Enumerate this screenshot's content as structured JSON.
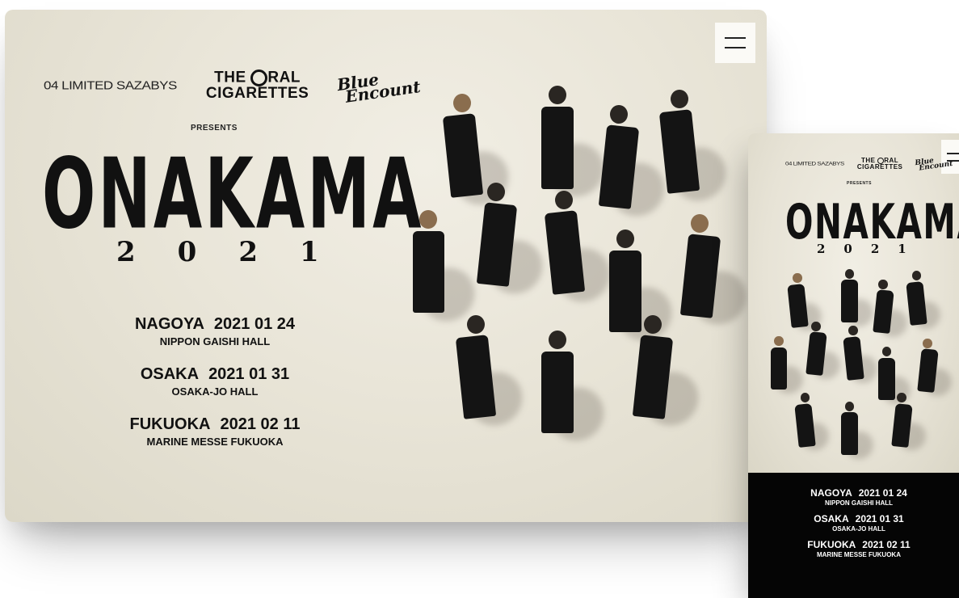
{
  "sponsors": {
    "ufs": "04 LIMITED SAZABYS",
    "toc_line1_a": "THE",
    "toc_line1_b": "RAL",
    "toc_line2": "CIGARETTES",
    "blue_line1": "Blue",
    "blue_line2": "Encount"
  },
  "presents": "PRESENTS",
  "title": "ONAKAMA",
  "year": "2021",
  "dates": [
    {
      "city": "NAGOYA",
      "date": "2021 01 24",
      "venue": "NIPPON GAISHI HALL"
    },
    {
      "city": "OSAKA",
      "date": "2021 01 31",
      "venue": "OSAKA-JO HALL"
    },
    {
      "city": "FUKUOKA",
      "date": "2021 02 11",
      "venue": "MARINE MESSE FUKUOKA"
    }
  ],
  "colors": {
    "background": "#e9e5d8",
    "ink": "#111111",
    "mobile_footer": "#050505"
  },
  "icons": {
    "menu": "hamburger-menu-icon"
  }
}
